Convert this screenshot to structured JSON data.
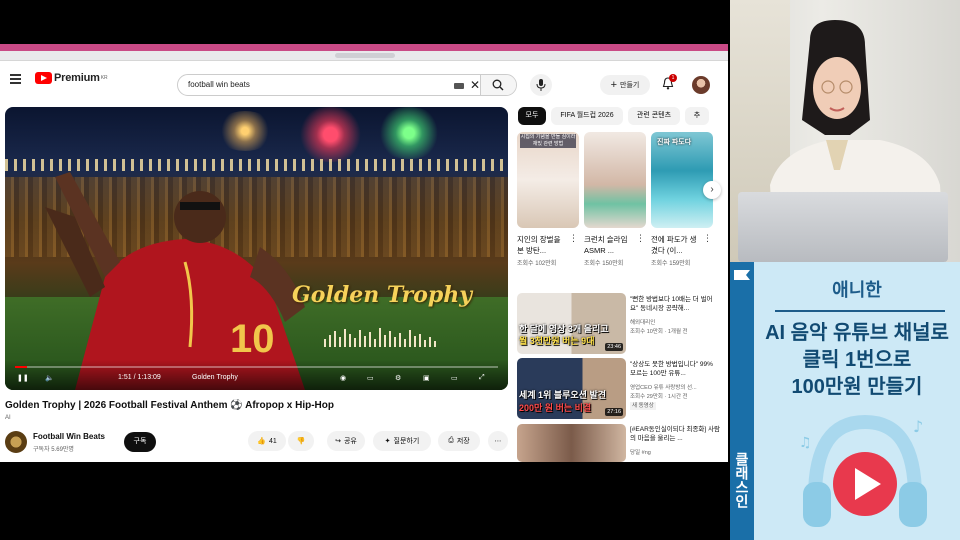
{
  "header": {
    "brand": "Premium",
    "brand_suffix": "KR",
    "search_query": "football win beats",
    "create_label": "만들기",
    "notif_count": "1"
  },
  "video": {
    "overlay_title": "Golden Trophy",
    "time_label": "1:51 / 1:13:09",
    "chapter_label": "Golden Trophy",
    "progress": 0.025,
    "title": "Golden Trophy | 2026 Football Festival Anthem ⚽ Afropop x Hip-Hop",
    "ai_label": "AI"
  },
  "channel": {
    "name": "Football Win Beats",
    "subs": "구독자 5.69만명",
    "subscribe_label": "구독"
  },
  "actions": {
    "like_count": "41",
    "share_label": "공유",
    "ask_label": "질문하기",
    "save_label": "저장"
  },
  "chips": [
    "모두",
    "FIFA 월드컵 2026",
    "관련 콘텐츠",
    "추"
  ],
  "shorts": [
    {
      "title": "지인의 장벌을 본 방탄...",
      "meta": "조회수 102만회",
      "overlay": "시집의 기념을 반들 심이라 재밌 관련 방법"
    },
    {
      "title": "크런치 슬라임 ASMR ...",
      "meta": "조회수 150만회",
      "overlay": ""
    },
    {
      "title": "전에 파도가 생겼다 (이...",
      "meta": "조회수 159만회",
      "overlay": "진짜 파도다"
    }
  ],
  "recommended": [
    {
      "title": "\"뻔한 방법보다 10배는 더 벌어요\" 동네시장 공략해...",
      "channel": "해외대리인",
      "meta": "조회수 10만회 · 1개월 전",
      "duration": "23:46",
      "caption1": "한 달에 영상 3개 올리고",
      "caption2": "월 3천만원 버는 9대"
    },
    {
      "title": "\"상상도 못한 방법입니다\" 99% 모르는 100만 유튜...",
      "channel": "영업CEO 유튜 사랑방의 선...",
      "meta": "조회수 29만회 · 1시간 전",
      "duration": "27:16",
      "caption1": "세계 1위 블루오션 발견",
      "caption2": "200만 원 버는 비결",
      "badge": "새 동영상"
    },
    {
      "title": "[#EAR동인실이되다 최종화] 사람의 마음을 울리는 ...",
      "channel": "당일 #ng",
      "meta": "",
      "duration": "",
      "caption1": "",
      "caption2": ""
    }
  ],
  "ad": {
    "brand_strip": "클래스인",
    "subtitle": "애니한",
    "headline_lines": [
      "AI 음악 유튜브 채널로",
      "클릭 1번으로",
      "100만원 만들기"
    ]
  },
  "colors": {
    "yt_red": "#ff0000",
    "ad_bg": "#cde9f6",
    "ad_strip": "#1a6fa8",
    "headline": "#114a72",
    "overlay_gold": "#f6d25a"
  }
}
